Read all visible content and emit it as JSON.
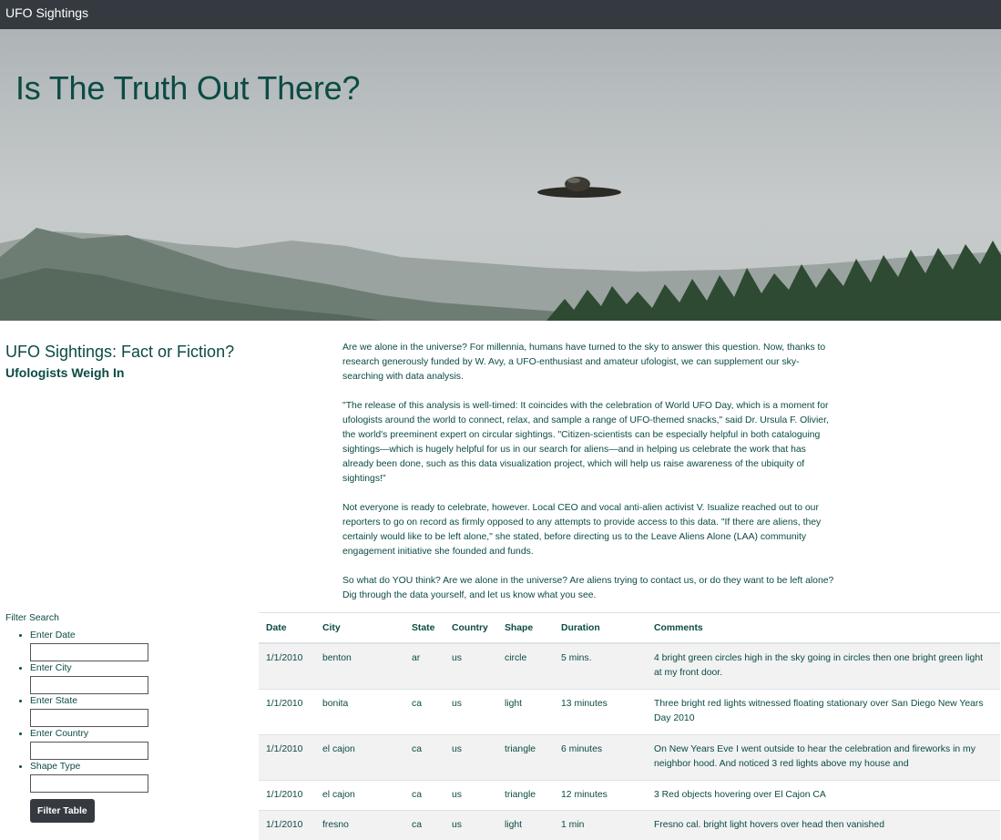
{
  "navbar": {
    "brand": "UFO Sightings"
  },
  "hero": {
    "title": "Is The Truth Out There?"
  },
  "side": {
    "title": "UFO Sightings: Fact or Fiction?",
    "subtitle": "Ufologists Weigh In"
  },
  "article": {
    "paragraphs": [
      "Are we alone in the universe? For millennia, humans have turned to the sky to answer this question. Now, thanks to research generously funded by W. Avy, a UFO-enthusiast and amateur ufologist, we can supplement our sky-searching with data analysis.",
      "\"The release of this analysis is well-timed: It coincides with the celebration of World UFO Day, which is a moment for ufologists around the world to connect, relax, and sample a range of UFO-themed snacks,\" said Dr. Ursula F. Olivier, the world's preeminent expert on circular sightings. \"Citizen-scientists can be especially helpful in both cataloguing sightings—which is hugely helpful for us in our search for aliens—and in helping us celebrate the work that has already been done, such as this data visualization project, which will help us raise awareness of the ubiquity of sightings!\"",
      "Not everyone is ready to celebrate, however. Local CEO and vocal anti-alien activist V. Isualize reached out to our reporters to go on record as firmly opposed to any attempts to provide access to this data. \"If there are aliens, they certainly would like to be left alone,\" she stated, before directing us to the Leave Aliens Alone (LAA) community engagement initiative she founded and funds.",
      "So what do YOU think? Are we alone in the universe? Are aliens trying to contact us, or do they want to be left alone? Dig through the data yourself, and let us know what you see."
    ]
  },
  "filter": {
    "title": "Filter Search",
    "fields": [
      {
        "label": "Enter Date",
        "value": ""
      },
      {
        "label": "Enter City",
        "value": ""
      },
      {
        "label": "Enter State",
        "value": ""
      },
      {
        "label": "Enter Country",
        "value": ""
      },
      {
        "label": "Shape Type",
        "value": ""
      }
    ],
    "button_label": "Filter Table"
  },
  "table": {
    "headers": [
      "Date",
      "City",
      "State",
      "Country",
      "Shape",
      "Duration",
      "Comments"
    ],
    "rows": [
      [
        "1/1/2010",
        "benton",
        "ar",
        "us",
        "circle",
        "5 mins.",
        "4 bright green circles high in the sky going in circles then one bright green light at my front door."
      ],
      [
        "1/1/2010",
        "bonita",
        "ca",
        "us",
        "light",
        "13 minutes",
        "Three bright red lights witnessed floating stationary over San Diego New Years Day 2010"
      ],
      [
        "1/1/2010",
        "el cajon",
        "ca",
        "us",
        "triangle",
        "6 minutes",
        "On New Years Eve I went outside to hear the celebration and fireworks in my neighbor hood. And noticed 3 red lights above my house and"
      ],
      [
        "1/1/2010",
        "el cajon",
        "ca",
        "us",
        "triangle",
        "12 minutes",
        "3 Red objects hovering over El Cajon CA"
      ],
      [
        "1/1/2010",
        "fresno",
        "ca",
        "us",
        "light",
        "1 min",
        "Fresno cal. bright light hovers over head then vanished"
      ]
    ]
  }
}
